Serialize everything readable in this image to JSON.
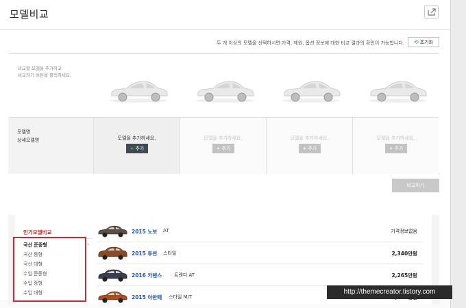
{
  "header": {
    "title": "모델비교"
  },
  "notice": "두 개 이상의 모델을 선택하시면 가격, 제원, 옵션 정보에 대한 비교 결과의 확인이 가능합니다.",
  "reset_label": "초기화",
  "guide_text": [
    "비교할 모델을 추가하고",
    "비교하기 버튼을 클릭하세요."
  ],
  "row_labels": {
    "model": "모델명",
    "detail": "상세모델명"
  },
  "slots": [
    {
      "text": "모델을 추가하세요.",
      "button": "추가"
    },
    {
      "text": "모델을 추가하세요.",
      "button": "추가"
    },
    {
      "text": "모델을 추가하세요.",
      "button": "추가"
    },
    {
      "text": "모델을 추가하세요.",
      "button": "추가"
    }
  ],
  "compare_label": "비교하기",
  "popular": {
    "title": "인기모델비교",
    "categories": [
      "국산 준중형",
      "국산 중형",
      "국산 대형",
      "수입 준중형",
      "수입 중형",
      "수입 대형"
    ],
    "rows": [
      {
        "name": "2015 노보",
        "trim": "AT",
        "price": "가격정보없음",
        "color": "#5b5048"
      },
      {
        "name": "2015 투싼",
        "trim": "스타일",
        "price": "2,340만원",
        "color": "#8a4a26"
      },
      {
        "name": "2016 카렌스",
        "trim": "트렌디 AT",
        "price": "2,265만원",
        "color": "#3b3f4a"
      },
      {
        "name": "2015 아반떼",
        "trim": "스타일 M/T",
        "price": "1,410만원",
        "color": "#a94f1f"
      }
    ]
  },
  "watermark": "http://themecreator.tistory.com",
  "colors": {
    "accent_red": "#e0202a",
    "link_blue": "#1d4fa3",
    "dark_button": "#3f4a52"
  }
}
